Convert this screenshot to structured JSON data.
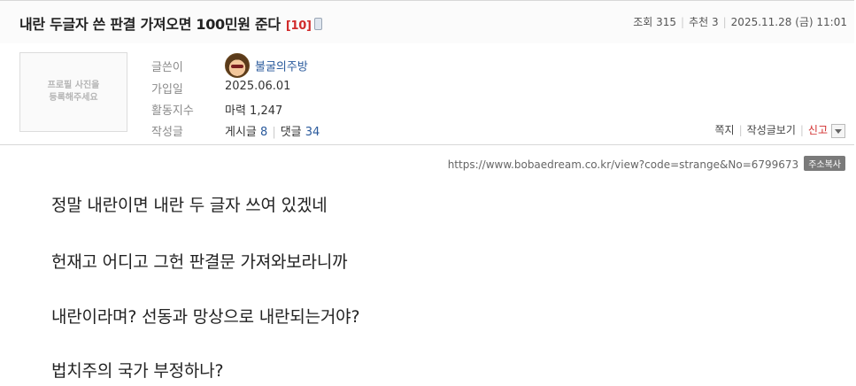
{
  "post": {
    "title": "내란 두글자 쓴 판결 가져오면 100민원 준다",
    "reply_count": "[10]",
    "device_icon": "mobile-phone-icon"
  },
  "meta": {
    "views_label": "조회 315",
    "recommend_label": "추천 3",
    "datetime": "2025.11.28 (금) 11:01"
  },
  "author": {
    "avatar_placeholder_line1": "프로필 사진을",
    "avatar_placeholder_line2": "등록해주세요",
    "labels": {
      "writer": "글쓴이",
      "joined": "가입일",
      "activity": "활동지수",
      "posts": "작성글"
    },
    "nickname": "불굴의주방",
    "joined_date": "2025.06.01",
    "activity_value": "마력 1,247",
    "posts_label": "게시글",
    "posts_count": "8",
    "comments_label": "댓글",
    "comments_count": "34"
  },
  "actions": {
    "message": "쪽지",
    "view_posts": "작성글보기",
    "report": "신고"
  },
  "url": {
    "text": "https://www.bobaedream.co.kr/view?code=strange&No=6799673",
    "copy_label": "주소복사"
  },
  "body": [
    "정말 내란이면 내란 두 글자 쓰여 있겠네",
    "헌재고 어디고 그헌 판결문 가져와보라니까",
    "내란이라며? 선동과 망상으로 내란되는거야?",
    "법치주의 국가 부정하나?"
  ]
}
